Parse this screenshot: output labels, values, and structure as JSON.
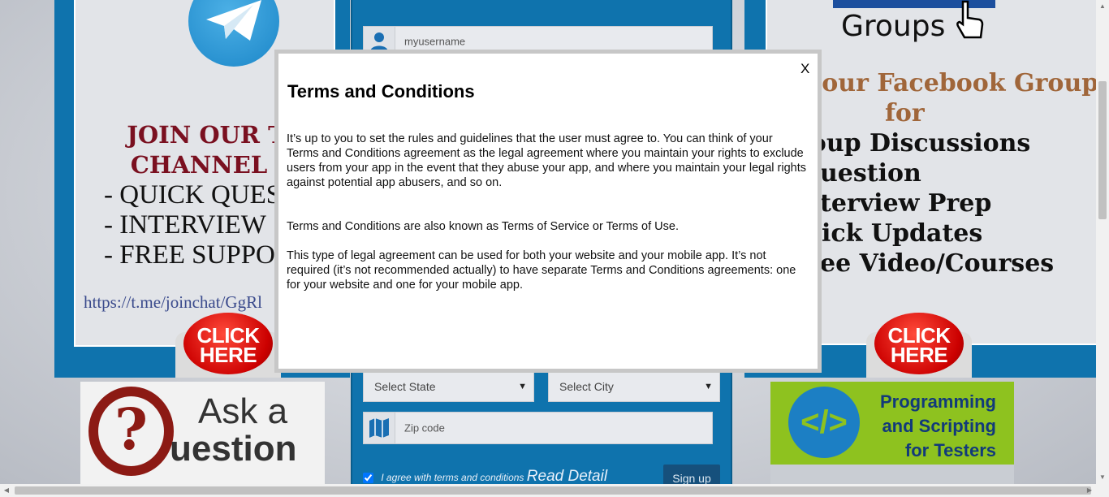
{
  "left_panel": {
    "title_line1": "JOIN OUR TE",
    "title_line2": "CHANNEL",
    "items": [
      "- QUICK QUES",
      "- INTERVIEW",
      "- FREE SUPPO"
    ],
    "link": "https://t.me/joinchat/GgRl"
  },
  "click_here": {
    "line1": "CLICK",
    "line2": "HERE"
  },
  "form": {
    "username_value": "myusername",
    "state_select": "Select State",
    "city_select": "Select City",
    "zip_placeholder": "Zip code",
    "agree_text": "I agree with terms and conditions",
    "read_detail": "Read Detail",
    "signup_label": "Sign up",
    "agree_checked": true
  },
  "right_panel": {
    "groups_label": "Groups",
    "title_line1": "n our Facebook Group",
    "title_line2": "for",
    "items": [
      "roup Discussions",
      "uestion",
      "terview Prep",
      "ick Updates",
      "ee Video/Courses"
    ]
  },
  "ask_tile": {
    "line1": "Ask a",
    "line2": "uestion",
    "glyph": "?"
  },
  "prog_tile": {
    "line1": "Programming",
    "line2": "and Scripting",
    "line3": "for Testers",
    "glyph": "</>"
  },
  "modal": {
    "close_label": "X",
    "title": "Terms and Conditions",
    "para1": "It’s up to you to set the rules and guidelines that the user must agree to. You can think of your Terms and Conditions agreement as the legal agreement where you maintain your rights to exclude users from your app in the event that they abuse your app, and where you maintain your legal rights against potential app abusers, and so on.",
    "para2": "Terms and Conditions are also known as Terms of Service or Terms of Use.",
    "para3": "This type of legal agreement can be used for both your website and your mobile app. It’s not required (it’s not recommended actually) to have separate Terms and Conditions agreements: one for your website and one for your mobile app."
  },
  "colors": {
    "brand_blue": "#0f73ad",
    "modal_bg": "#ffffff",
    "click_red": "#cc0000"
  },
  "icons": [
    "telegram-icon",
    "user-icon",
    "map-icon",
    "hand-cursor-icon",
    "code-icon",
    "question-icon"
  ]
}
